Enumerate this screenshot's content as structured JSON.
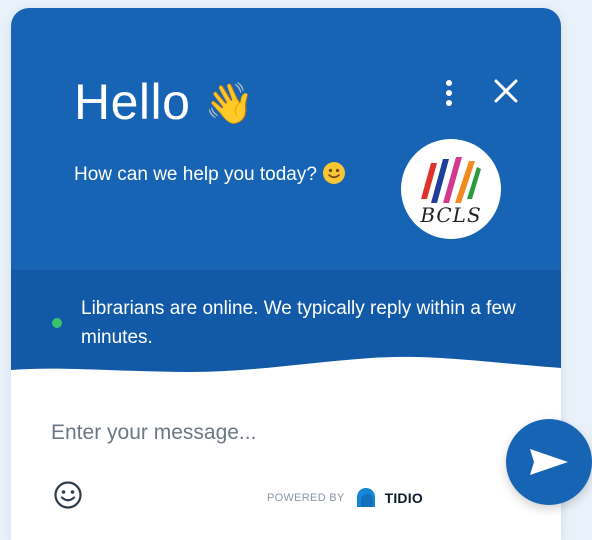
{
  "colors": {
    "header_bg": "#1764b4",
    "status_band_bg": "#125aa8",
    "online_dot": "#3cc16b",
    "page_bg": "#e9f1fb"
  },
  "header": {
    "greeting": "Hello",
    "greeting_emoji": "👋",
    "subtitle": "How can we help you today?",
    "subtitle_emoji_icon": "slightly-smiling-face-icon",
    "menu_icon": "kebab-menu-icon",
    "close_icon": "close-icon"
  },
  "avatar": {
    "label": "BCLS"
  },
  "status": {
    "text": "Librarians are online. We typically reply within a few minutes.",
    "online": true
  },
  "composer": {
    "placeholder": "Enter your message...",
    "emoji_icon": "emoji-smile-icon",
    "send_icon": "send-arrow-icon"
  },
  "footer": {
    "powered_by": "POWERED BY",
    "brand": "TIDIO"
  }
}
